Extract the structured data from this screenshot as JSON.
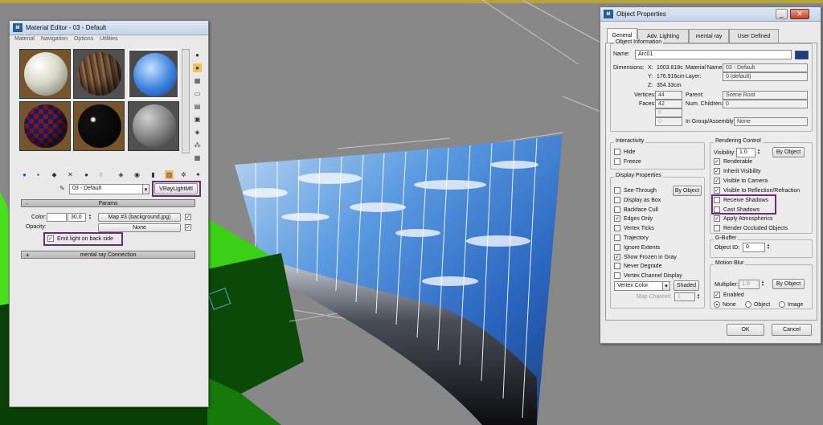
{
  "material_editor": {
    "title": "Material Editor - 03 - Default",
    "menu": [
      "Material",
      "Navigation",
      "Options",
      "Utilities"
    ],
    "material_name": "03 - Default",
    "material_type": "VRayLightMtl",
    "params_rollout": "Params",
    "color_label": "Color:",
    "color_value": "30,0",
    "color_map": "Map #3 (background.jpg)",
    "opacity_label": "Opacity:",
    "opacity_map": "None",
    "emit_back_label": "Emit light on back side",
    "mental_ray_rollout": "mental ray Connection",
    "rollout_minus": "-",
    "rollout_plus": "+"
  },
  "object_properties": {
    "title": "Object Properties",
    "tabs": [
      "General",
      "Adv. Lighting",
      "mental ray",
      "User Defined"
    ],
    "object_info_title": "Object Information",
    "name_label": "Name:",
    "name_value": "Arc01",
    "color_swatch": "#1a3a8a",
    "dimensions_label": "Dimensions:",
    "x_label": "X:",
    "x_value": "1003.818c",
    "y_label": "Y:",
    "y_value": "176.916cm",
    "z_label": "Z:",
    "z_value": "354.33cm",
    "material_name_label": "Material Name:",
    "material_name_value": "03 - Default",
    "layer_label": "Layer:",
    "layer_value": "0 (default)",
    "vertices_label": "Vertices:",
    "vertices_value": "44",
    "faces_label": "Faces:",
    "faces_value": "42",
    "parent_label": "Parent:",
    "parent_value": "Scene Root",
    "num_children_label": "Num. Children:",
    "num_children_value": "0",
    "blank1": "0",
    "blank2": "0",
    "in_group_label": "In Group/Assembly:",
    "in_group_value": "None",
    "interactivity_title": "Interactivity",
    "hide_label": "Hide",
    "freeze_label": "Freeze",
    "display_props_title": "Display Properties",
    "by_object": "By Object",
    "see_through": "See-Through",
    "display_as_box": "Display as Box",
    "backface_cull": "Backface Cull",
    "edges_only": "Edges Only",
    "vertex_ticks": "Vertex Ticks",
    "trajectory": "Trajectory",
    "ignore_extents": "Ignore Extents",
    "show_frozen": "Show Frozen in Gray",
    "never_degrade": "Never Degrade",
    "vertex_channel": "Vertex Channel Display",
    "vertex_color": "Vertex Color",
    "shaded": "Shaded",
    "map_channel_label": "Map Channel:",
    "map_channel_value": "1",
    "rendering_title": "Rendering Control",
    "visibility_label": "Visibility:",
    "visibility_value": "1.0",
    "renderable": "Renderable",
    "inherit_visibility": "Inherit Visibility",
    "visible_camera": "Visible to Camera",
    "visible_reflection": "Visible to Reflection/Refraction",
    "receive_shadows": "Receive Shadows",
    "cast_shadows": "Cast Shadows",
    "apply_atmospherics": "Apply Atmospherics",
    "render_occluded": "Render Occluded Objects",
    "gbuffer_title": "G-Buffer",
    "object_id_label": "Object ID:",
    "object_id_value": "0",
    "motion_blur_title": "Motion Blur",
    "multiplier_label": "Multiplier:",
    "multiplier_value": "1.0",
    "enabled": "Enabled",
    "none": "None",
    "object": "Object",
    "image": "Image",
    "ok": "OK",
    "cancel": "Cancel",
    "check": "✓"
  },
  "colors": {
    "highlight": "#6b2a7a",
    "green_object": "#3fd21a",
    "sky": "#3a7ad0"
  }
}
